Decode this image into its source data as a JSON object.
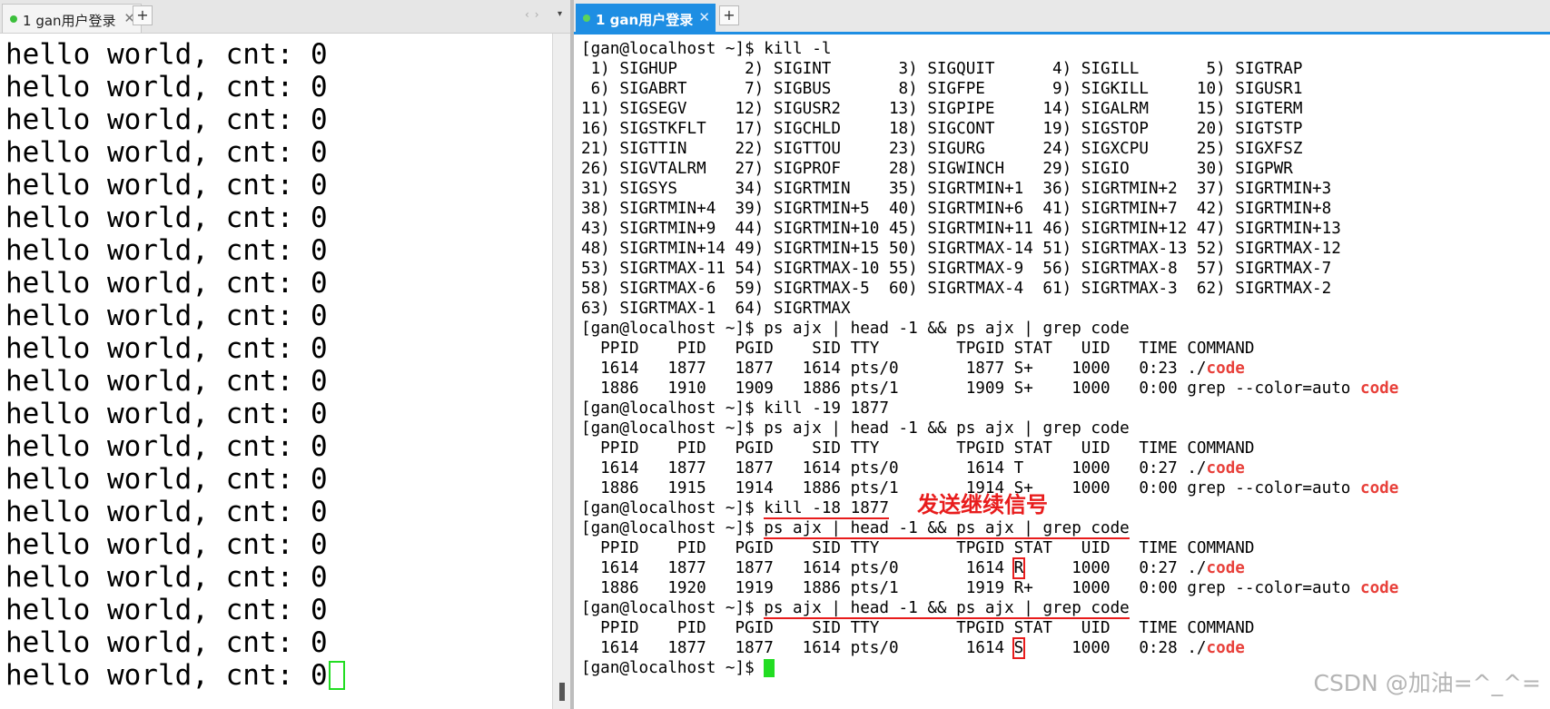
{
  "left_tab": {
    "index": "1",
    "title": "gan用户登录"
  },
  "right_tab": {
    "index": "1",
    "title": "gan用户登录"
  },
  "tab_add_label": "+",
  "tab_close_label": "✕",
  "left_output": {
    "line_text": "hello world, cnt: 0",
    "line_count": 20
  },
  "annotation": "发送继续信号",
  "watermark": "CSDN @加油=^_^=",
  "colors": {
    "accent": "#1e8ee3",
    "highlight": "#e8403a",
    "cursor": "#22dd22"
  },
  "terminal": {
    "prompt": "[gan@localhost ~]$ ",
    "cmd_kill_l": "kill -l",
    "signals": [
      " 1) SIGHUP       2) SIGINT       3) SIGQUIT      4) SIGILL       5) SIGTRAP",
      " 6) SIGABRT      7) SIGBUS       8) SIGFPE       9) SIGKILL     10) SIGUSR1",
      "11) SIGSEGV     12) SIGUSR2     13) SIGPIPE     14) SIGALRM     15) SIGTERM",
      "16) SIGSTKFLT   17) SIGCHLD     18) SIGCONT     19) SIGSTOP     20) SIGTSTP",
      "21) SIGTTIN     22) SIGTTOU     23) SIGURG      24) SIGXCPU     25) SIGXFSZ",
      "26) SIGVTALRM   27) SIGPROF     28) SIGWINCH    29) SIGIO       30) SIGPWR",
      "31) SIGSYS      34) SIGRTMIN    35) SIGRTMIN+1  36) SIGRTMIN+2  37) SIGRTMIN+3",
      "38) SIGRTMIN+4  39) SIGRTMIN+5  40) SIGRTMIN+6  41) SIGRTMIN+7  42) SIGRTMIN+8",
      "43) SIGRTMIN+9  44) SIGRTMIN+10 45) SIGRTMIN+11 46) SIGRTMIN+12 47) SIGRTMIN+13",
      "48) SIGRTMIN+14 49) SIGRTMIN+15 50) SIGRTMAX-14 51) SIGRTMAX-13 52) SIGRTMAX-12",
      "53) SIGRTMAX-11 54) SIGRTMAX-10 55) SIGRTMAX-9  56) SIGRTMAX-8  57) SIGRTMAX-7",
      "58) SIGRTMAX-6  59) SIGRTMAX-5  60) SIGRTMAX-4  61) SIGRTMAX-3  62) SIGRTMAX-2",
      "63) SIGRTMAX-1  64) SIGRTMAX"
    ],
    "cmd_ps": "ps ajx | head -1 && ps ajx | grep code",
    "ps_header": "  PPID    PID   PGID    SID TTY        TPGID STAT   UID   TIME COMMAND",
    "cmd_stop": "kill -19 1877",
    "cmd_cont": "kill -18 1877",
    "run_cmd_prefix": "./",
    "grep_cmd_prefix": "grep --color=auto ",
    "process_name": "code",
    "ps1": [
      {
        "pre": "  1614   1877   1877   1614 pts/0       1877 ",
        "stat": "S+",
        "post": "    1000   0:23 ",
        "kind": "run"
      },
      {
        "pre": "  1886   1910   1909   1886 pts/1       1909 ",
        "stat": "S+",
        "post": "    1000   0:00 ",
        "kind": "grep"
      }
    ],
    "ps2": [
      {
        "pre": "  1614   1877   1877   1614 pts/0       1614 ",
        "stat": "T",
        "post": "     1000   0:27 ",
        "kind": "run"
      },
      {
        "pre": "  1886   1915   1914   1886 pts/1       1914 ",
        "stat": "S+",
        "post": "    1000   0:00 ",
        "kind": "grep"
      }
    ],
    "ps3": [
      {
        "pre": "  1614   1877   1877   1614 pts/0       1614 ",
        "stat": "R",
        "post": "     1000   0:27 ",
        "kind": "run"
      },
      {
        "pre": "  1886   1920   1919   1886 pts/1       1919 ",
        "stat": "R+",
        "post": "    1000   0:00 ",
        "kind": "grep"
      }
    ],
    "ps4": [
      {
        "pre": "  1614   1877   1877   1614 pts/0       1614 ",
        "stat": "S",
        "post": "     1000   0:28 ",
        "kind": "run"
      }
    ]
  }
}
